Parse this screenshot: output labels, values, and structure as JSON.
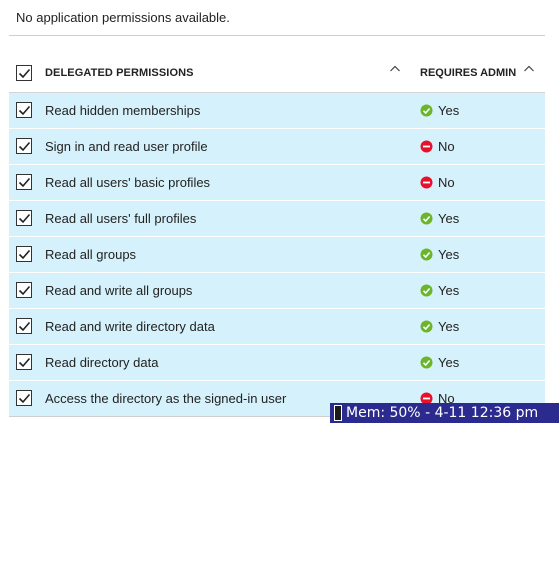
{
  "message": "No application permissions available.",
  "header": {
    "delegated_label": "DELEGATED PERMISSIONS",
    "admin_label": "REQUIRES ADMIN"
  },
  "permissions": [
    {
      "label": "Read hidden memberships",
      "requires_admin": "Yes",
      "status": "yes"
    },
    {
      "label": "Sign in and read user profile",
      "requires_admin": "No",
      "status": "no"
    },
    {
      "label": "Read all users' basic profiles",
      "requires_admin": "No",
      "status": "no"
    },
    {
      "label": "Read all users' full profiles",
      "requires_admin": "Yes",
      "status": "yes"
    },
    {
      "label": "Read all groups",
      "requires_admin": "Yes",
      "status": "yes"
    },
    {
      "label": "Read and write all groups",
      "requires_admin": "Yes",
      "status": "yes"
    },
    {
      "label": "Read and write directory data",
      "requires_admin": "Yes",
      "status": "yes"
    },
    {
      "label": "Read directory data",
      "requires_admin": "Yes",
      "status": "yes"
    },
    {
      "label": "Access the directory as the signed-in user",
      "requires_admin": "No",
      "status": "no"
    }
  ],
  "overlay": {
    "text": "Mem: 50% - 4-11   12:36 pm"
  },
  "colors": {
    "row_bg": "#d5f1fb",
    "yes": "#6bb52a",
    "no": "#e8112d",
    "overlay_bg": "#2b2a8e"
  }
}
